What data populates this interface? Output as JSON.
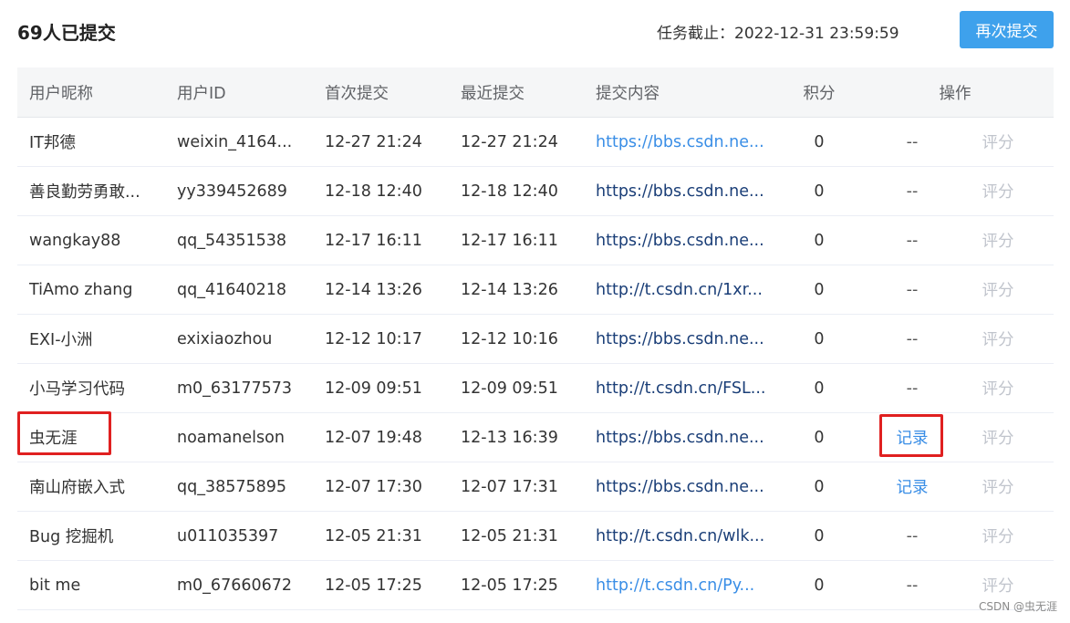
{
  "header": {
    "title": "69人已提交",
    "deadline": "任务截止：2022-12-31 23:59:59",
    "resubmit_label": "再次提交"
  },
  "table": {
    "columns": [
      "用户昵称",
      "用户ID",
      "首次提交",
      "最近提交",
      "提交内容",
      "积分",
      "操作"
    ],
    "rows": [
      {
        "name": "IT邦德",
        "id": "weixin_4164...",
        "first": "12-27 21:24",
        "last": "12-27 21:24",
        "content": "https://bbs.csdn.ne...",
        "content_style": "light",
        "score": "0",
        "op": "--",
        "rate": "评分"
      },
      {
        "name": "善良勤劳勇敢...",
        "id": "yy339452689",
        "first": "12-18 12:40",
        "last": "12-18 12:40",
        "content": "https://bbs.csdn.ne...",
        "content_style": "dark",
        "score": "0",
        "op": "--",
        "rate": "评分"
      },
      {
        "name": "wangkay88",
        "id": "qq_54351538",
        "first": "12-17 16:11",
        "last": "12-17 16:11",
        "content": "https://bbs.csdn.ne...",
        "content_style": "dark",
        "score": "0",
        "op": "--",
        "rate": "评分"
      },
      {
        "name": "TiAmo zhang",
        "id": "qq_41640218",
        "first": "12-14 13:26",
        "last": "12-14 13:26",
        "content": "http://t.csdn.cn/1xr...",
        "content_style": "dark",
        "score": "0",
        "op": "--",
        "rate": "评分"
      },
      {
        "name": "EXI-小洲",
        "id": "exixiaozhou",
        "first": "12-12 10:17",
        "last": "12-12 10:16",
        "content": "https://bbs.csdn.ne...",
        "content_style": "dark",
        "score": "0",
        "op": "--",
        "rate": "评分"
      },
      {
        "name": "小马学习代码",
        "id": "m0_63177573",
        "first": "12-09 09:51",
        "last": "12-09 09:51",
        "content": "http://t.csdn.cn/FSL...",
        "content_style": "dark",
        "score": "0",
        "op": "--",
        "rate": "评分"
      },
      {
        "name": "虫无涯",
        "id": "noamanelson",
        "first": "12-07 19:48",
        "last": "12-13 16:39",
        "content": "https://bbs.csdn.ne...",
        "content_style": "dark",
        "score": "0",
        "op": "记录",
        "rate": "评分"
      },
      {
        "name": "南山府嵌入式",
        "id": "qq_38575895",
        "first": "12-07 17:30",
        "last": "12-07 17:31",
        "content": "https://bbs.csdn.ne...",
        "content_style": "dark",
        "score": "0",
        "op": "记录",
        "rate": "评分"
      },
      {
        "name": "Bug 挖掘机",
        "id": "u011035397",
        "first": "12-05 21:31",
        "last": "12-05 21:31",
        "content": "http://t.csdn.cn/wlk...",
        "content_style": "dark",
        "score": "0",
        "op": "--",
        "rate": "评分"
      },
      {
        "name": "bit me",
        "id": "m0_67660672",
        "first": "12-05 17:25",
        "last": "12-05 17:25",
        "content": "http://t.csdn.cn/Py...",
        "content_style": "light",
        "score": "0",
        "op": "--",
        "rate": "评分"
      }
    ]
  },
  "watermark": "CSDN @虫无涯",
  "colors": {
    "accent": "#3ea1ec",
    "link": "#3a8ee6",
    "highlight": "#e02020",
    "disabled": "#c0c4cc"
  }
}
